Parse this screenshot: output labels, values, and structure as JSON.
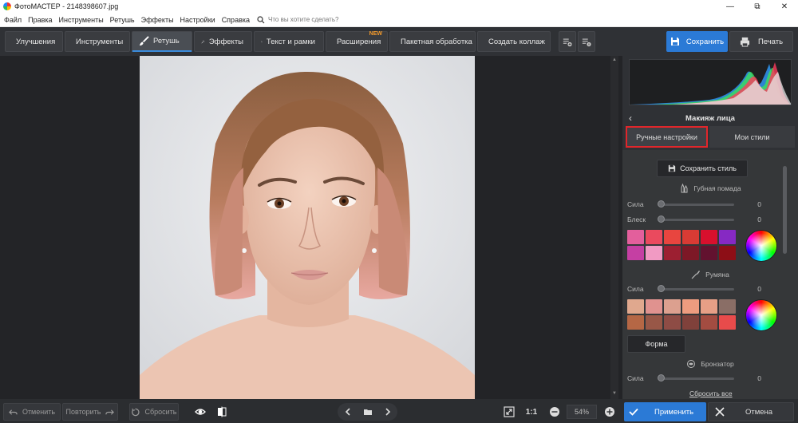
{
  "window": {
    "title": "ФотоМАСТЕР - 2148398607.jpg",
    "min_label": "—",
    "restore_label": "⧉",
    "close_label": "✕"
  },
  "menu": {
    "items": [
      "Файл",
      "Правка",
      "Инструменты",
      "Ретушь",
      "Эффекты",
      "Настройки",
      "Справка"
    ],
    "search_placeholder": "Что вы хотите сделать?"
  },
  "toolbar": {
    "tabs": [
      {
        "label": "Улучшения",
        "icon": "sliders-icon"
      },
      {
        "label": "Инструменты",
        "icon": "crop-icon"
      },
      {
        "label": "Ретушь",
        "icon": "brush-icon",
        "active": true
      },
      {
        "label": "Эффекты",
        "icon": "magic-wand-icon"
      },
      {
        "label": "Текст и рамки",
        "icon": "text-icon"
      },
      {
        "label": "Расширения",
        "icon": "plus-icon",
        "badge": "NEW"
      },
      {
        "label": "Пакетная обработка",
        "icon": "images-icon"
      },
      {
        "label": "Создать коллаж",
        "icon": "collage-icon"
      }
    ],
    "save_label": "Сохранить",
    "print_label": "Печать"
  },
  "panel": {
    "title": "Макияж лица",
    "tabs": {
      "manual": "Ручные настройки",
      "styles": "Мои стили"
    },
    "save_style_label": "Сохранить стиль",
    "lipstick": {
      "title": "Губная помада",
      "sliders": [
        {
          "label": "Сила",
          "value": "0"
        },
        {
          "label": "Блеск",
          "value": "0"
        }
      ],
      "swatches": [
        "#e35f9c",
        "#ea4a5e",
        "#e8453f",
        "#d93b34",
        "#d8102d",
        "#8629c3",
        "#c53fa3",
        "#f19ac3",
        "#9c1f31",
        "#7d1826",
        "#62122f",
        "#8d0e16"
      ]
    },
    "blush": {
      "title": "Румяна",
      "sliders": [
        {
          "label": "Сила",
          "value": "0"
        }
      ],
      "swatches": [
        "#e0a88e",
        "#e0928f",
        "#dca08f",
        "#ee9c7f",
        "#e79f86",
        "#8a6e66",
        "#b56745",
        "#985747",
        "#8e4c45",
        "#80413b",
        "#a34c41",
        "#e84b4b"
      ],
      "shape_label": "Форма"
    },
    "bronzer": {
      "title": "Бронзатор",
      "sliders": [
        {
          "label": "Сила",
          "value": "0"
        }
      ]
    },
    "reset_all_label": "Сбросить все"
  },
  "bottom": {
    "undo_label": "Отменить",
    "redo_label": "Повторить",
    "reset_label": "Сбросить",
    "ratio_label": "1:1",
    "zoom_value": "54%",
    "apply_label": "Применить",
    "cancel_label": "Отмена"
  },
  "colors": {
    "accent": "#2b7ad6",
    "highlight_border": "#e0262b",
    "new_badge": "#f39a2b"
  }
}
